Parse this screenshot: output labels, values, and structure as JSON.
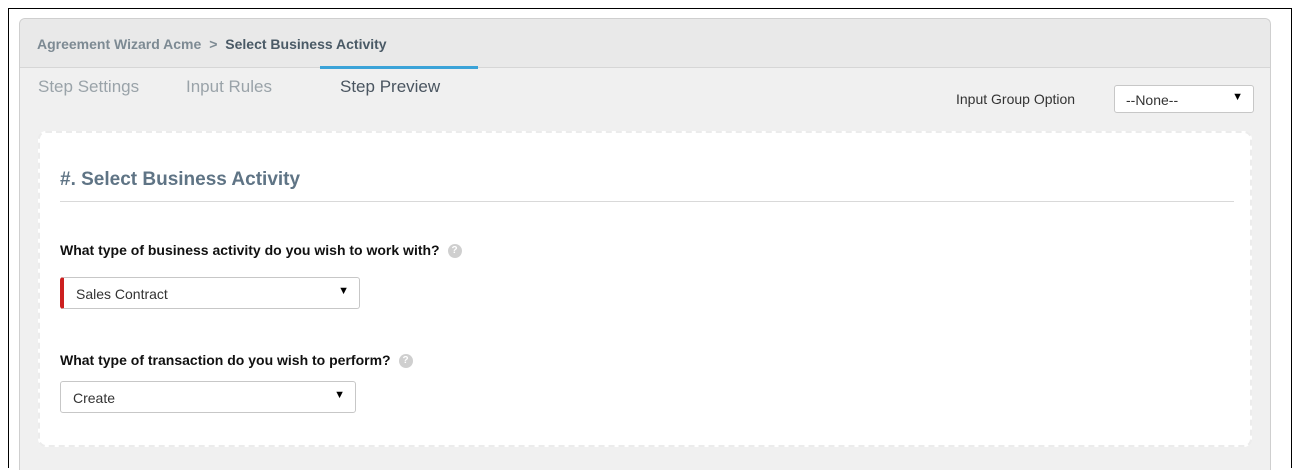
{
  "breadcrumb": {
    "root": "Agreement Wizard Acme",
    "separator": ">",
    "current": "Select Business Activity"
  },
  "tabs": [
    {
      "label": "Step Settings",
      "active": false
    },
    {
      "label": "Input Rules",
      "active": false
    },
    {
      "label": "Step Preview",
      "active": true
    }
  ],
  "input_group": {
    "label": "Input Group Option",
    "value": "--None--"
  },
  "preview": {
    "title": "#. Select Business Activity",
    "questions": [
      {
        "text": "What type of business activity do you wish to work with?",
        "value": "Sales Contract",
        "required": true
      },
      {
        "text": "What type of transaction do you wish to perform?",
        "value": "Create",
        "required": false
      }
    ]
  },
  "icons": {
    "help": "question-circle-icon",
    "dropdown": "caret-down-icon"
  },
  "colors": {
    "accent_tab_underline": "#3ba3d8",
    "required_marker": "#cc1f1f",
    "section_title": "#5f7485"
  }
}
